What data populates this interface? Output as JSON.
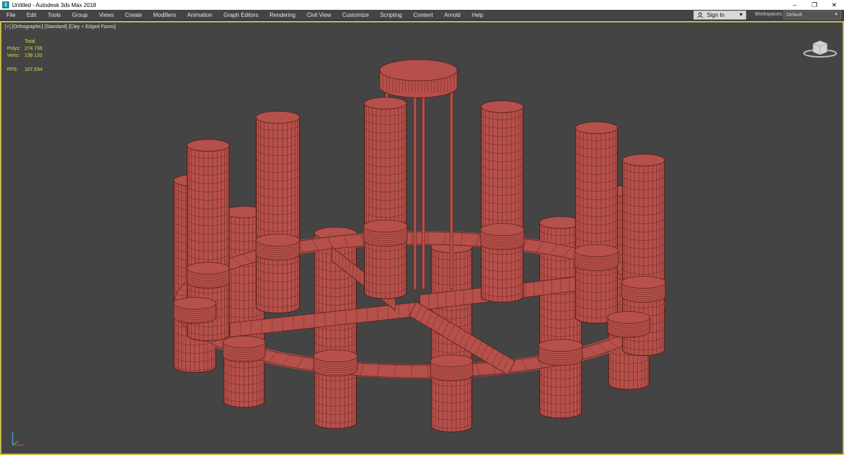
{
  "window": {
    "title": "Untitled - Autodesk 3ds Max 2018",
    "app_icon_letter": "3",
    "minimize_glyph": "–",
    "restore_glyph": "❐",
    "close_glyph": "✕"
  },
  "menubar": {
    "items": [
      "File",
      "Edit",
      "Tools",
      "Group",
      "Views",
      "Create",
      "Modifiers",
      "Animation",
      "Graph Editors",
      "Rendering",
      "Civil View",
      "Customize",
      "Scripting",
      "Content",
      "Arnold",
      "Help"
    ]
  },
  "signin": {
    "label": "Sign In",
    "caret": "▼"
  },
  "workspaces": {
    "label": "Workspaces:",
    "value": "Default",
    "caret": "▼"
  },
  "viewport": {
    "label": "[+] [Orthographic] [Standard] [Clay + Edged Faces]",
    "stats": {
      "header": "Total",
      "polys_label": "Polys:",
      "polys_value": "274 736",
      "verts_label": "Verts:",
      "verts_value": "138 132",
      "fps_label": "FPS:",
      "fps_value": "107,034"
    },
    "model_name": "chandelier",
    "colors": {
      "viewport_bg": "#444444",
      "active_border": "#c8b84a",
      "stats_text": "#e6d84a",
      "model_fill": "#b5504a",
      "model_wire": "#5a1d1a"
    }
  }
}
